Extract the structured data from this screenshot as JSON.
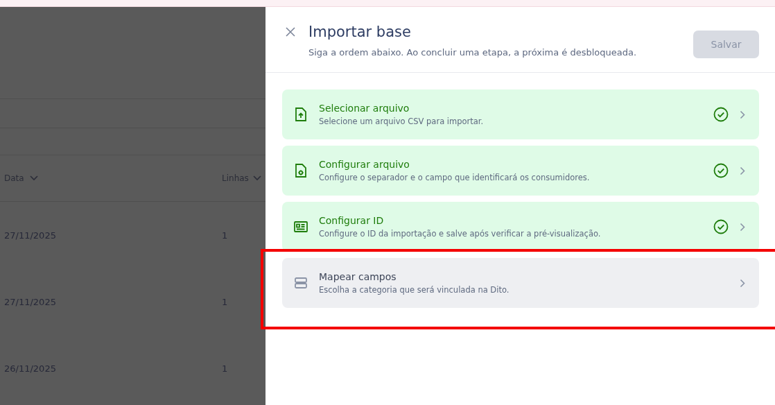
{
  "background_table": {
    "columns": [
      {
        "label": "Data"
      },
      {
        "label": "Linhas"
      }
    ],
    "rows": [
      {
        "date": "27/11/2025",
        "lines": "1"
      },
      {
        "date": "27/11/2025",
        "lines": "1"
      },
      {
        "date": "26/11/2025",
        "lines": "1"
      }
    ]
  },
  "drawer": {
    "title": "Importar base",
    "subtitle": "Siga a ordem abaixo. Ao concluir uma etapa, a próxima é desbloqueada.",
    "save_button": {
      "label": "Salvar",
      "disabled": true
    },
    "steps": [
      {
        "title": "Selecionar arquivo",
        "description": "Selecione um arquivo CSV para importar.",
        "completed": true,
        "highlighted": false
      },
      {
        "title": "Configurar arquivo",
        "description": "Configure o separador e o campo que identificará os consumidores.",
        "completed": true,
        "highlighted": false
      },
      {
        "title": "Configurar ID",
        "description": "Configure o ID da importação e salve após verificar a pré-visualização.",
        "completed": true,
        "highlighted": false
      },
      {
        "title": "Mapear campos",
        "description": "Escolha a categoria que será vinculada na Dito.",
        "completed": false,
        "highlighted": true
      }
    ]
  }
}
